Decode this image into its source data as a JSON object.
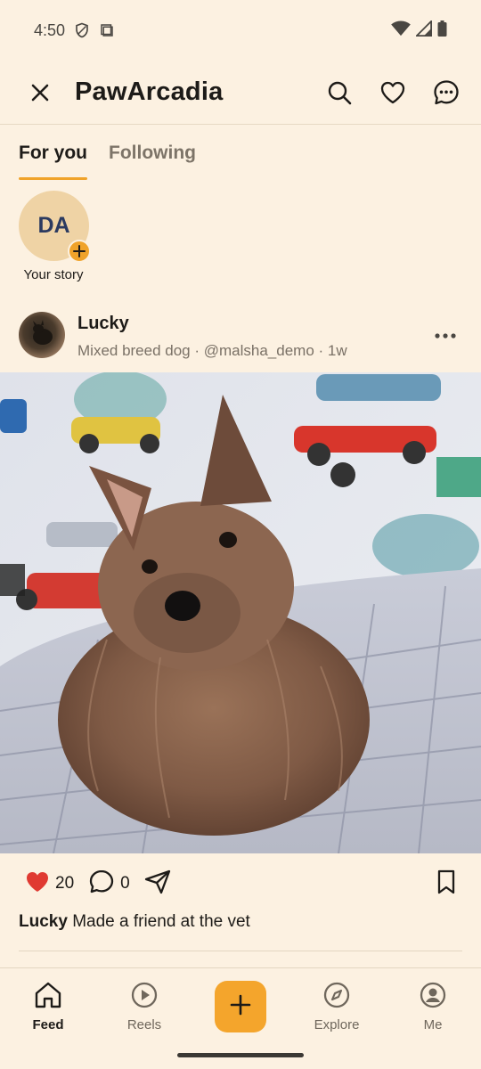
{
  "status": {
    "time": "4:50"
  },
  "app": {
    "title": "PawArcadia"
  },
  "tabs": [
    {
      "label": "For you",
      "active": true
    },
    {
      "label": "Following",
      "active": false
    }
  ],
  "stories": [
    {
      "initials": "DA",
      "label": "Your story"
    }
  ],
  "post": {
    "author": "Lucky",
    "subtitle": "Mixed breed dog · @malsha_demo · 1w",
    "likes": "20",
    "comments": "0",
    "caption_author": "Lucky",
    "caption_text": "Made a friend at the vet",
    "liked": true
  },
  "bottom_nav": [
    {
      "label": "Feed",
      "icon": "home-icon",
      "active": true
    },
    {
      "label": "Reels",
      "icon": "play-icon",
      "active": false
    },
    {
      "label": "",
      "icon": "plus-icon",
      "active": false
    },
    {
      "label": "Explore",
      "icon": "compass-icon",
      "active": false
    },
    {
      "label": "Me",
      "icon": "person-icon",
      "active": false
    }
  ],
  "colors": {
    "accent": "#f0a32a",
    "like": "#e03a32",
    "background": "#fcf1e1"
  }
}
